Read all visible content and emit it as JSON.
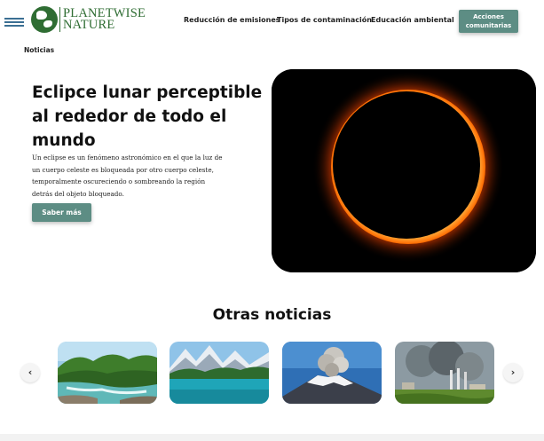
{
  "brand": {
    "name_line1": "PLANETWISE",
    "name_line2": "NATURE"
  },
  "nav": {
    "items": [
      {
        "label": "Reducción de emisiones"
      },
      {
        "label": "Tipos de contaminación"
      },
      {
        "label": "Educación ambiental"
      }
    ],
    "cta_label": "Acciones comunitarias"
  },
  "section_label": "Noticias",
  "hero": {
    "title": "Eclipce lunar perceptible al rededor de todo el mundo",
    "body": "Un eclipse es un fenómeno astronómico en el que la luz de un cuerpo celeste es bloqueada por otro cuerpo celeste, temporalmente oscureciendo o sombreando la región detrás del objeto bloqueado.",
    "button_label": "Saber más"
  },
  "other_news": {
    "title": "Otras noticias",
    "prev_icon": "chevron-left-icon",
    "next_icon": "chevron-right-icon",
    "prev_glyph": "‹",
    "next_glyph": "›"
  },
  "colors": {
    "brand_green": "#2f6d33",
    "button_teal": "#5d8d84",
    "menu_blue": "#3b6f93"
  }
}
